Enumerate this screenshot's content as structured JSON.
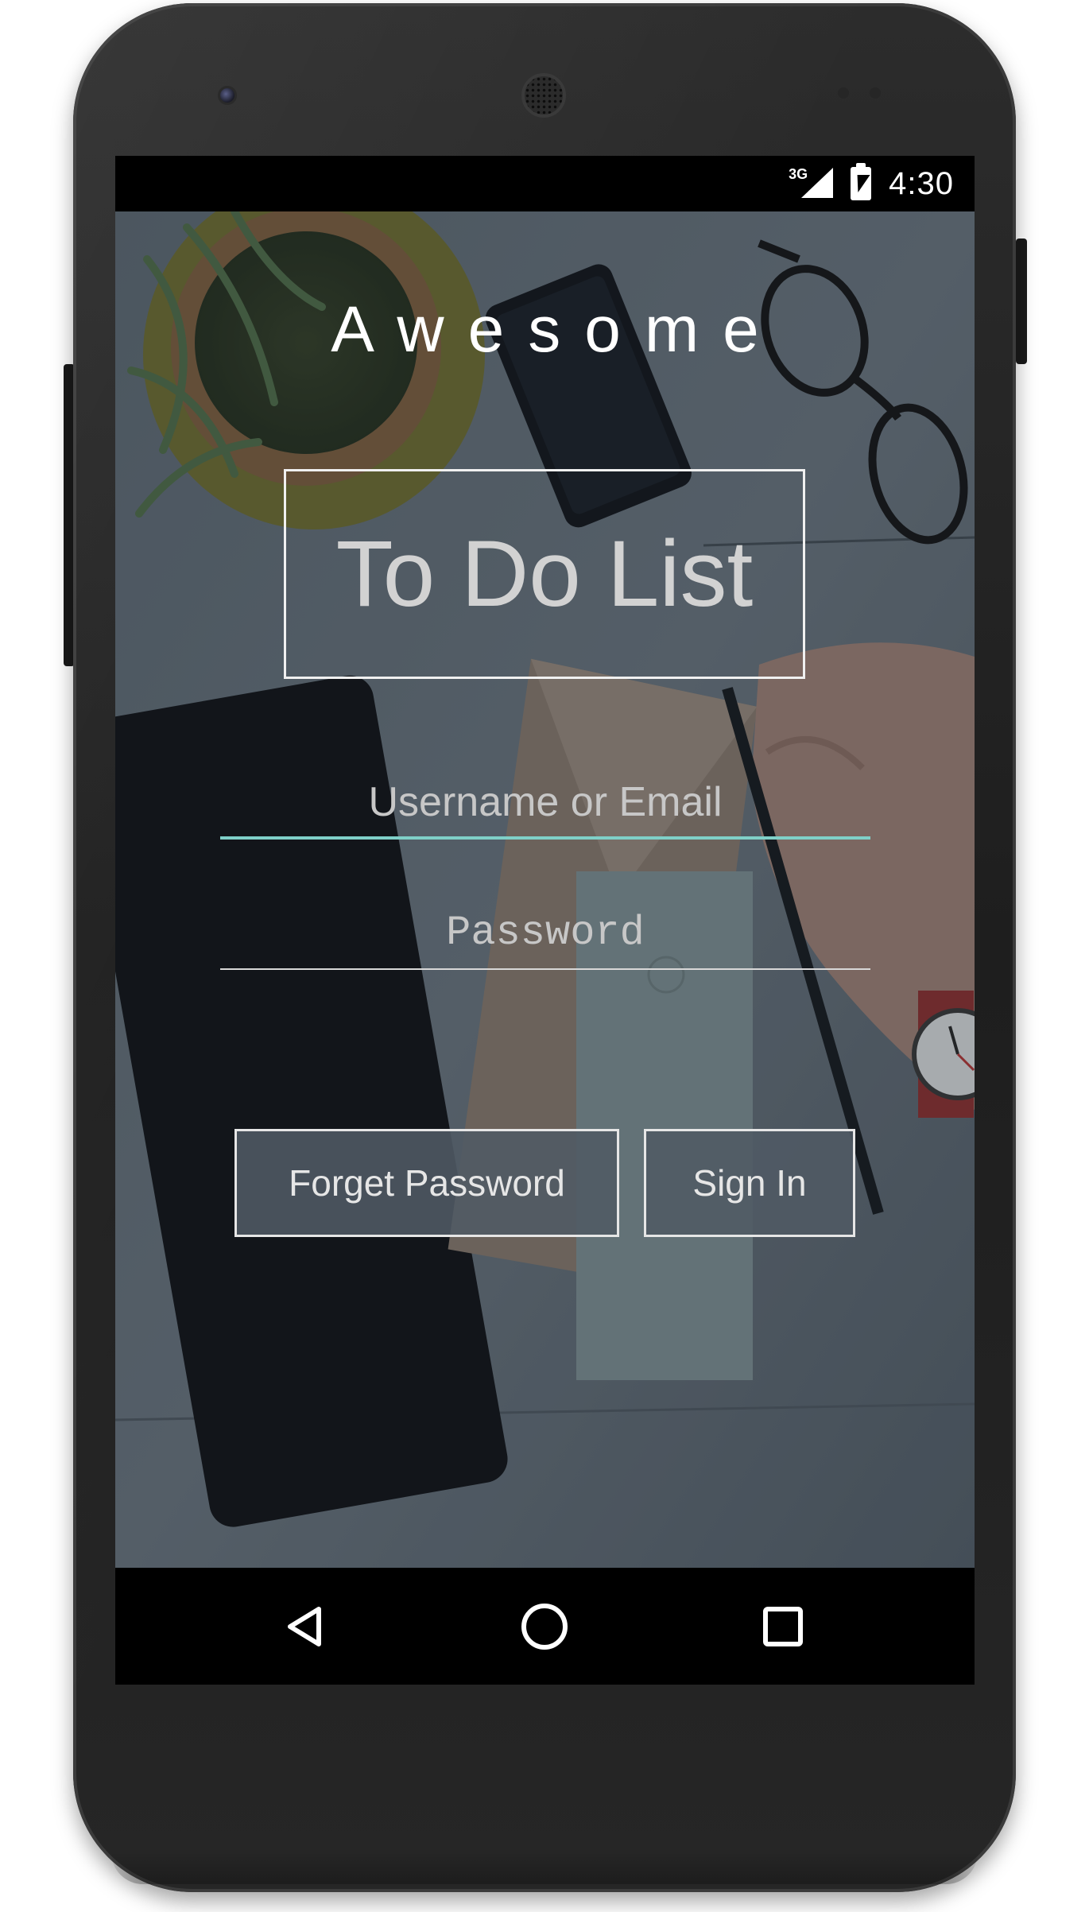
{
  "status_bar": {
    "network_type": "3G",
    "time": "4:30",
    "icons": [
      "signal-icon",
      "battery-charging-icon"
    ]
  },
  "app": {
    "brand": "Awesome",
    "title": "To Do List",
    "username_field": {
      "value": "",
      "placeholder": "Username or Email"
    },
    "password_field": {
      "value": "",
      "placeholder": "Password"
    },
    "buttons": {
      "forget_password": "Forget Password",
      "sign_in": "Sign In"
    },
    "colors": {
      "accent_underline": "#7fd0c8",
      "button_border": "#e6e6e6",
      "title_text": "#d2d2d2"
    }
  },
  "nav_bar": {
    "icons": [
      "back-icon",
      "home-icon",
      "recents-icon"
    ]
  }
}
